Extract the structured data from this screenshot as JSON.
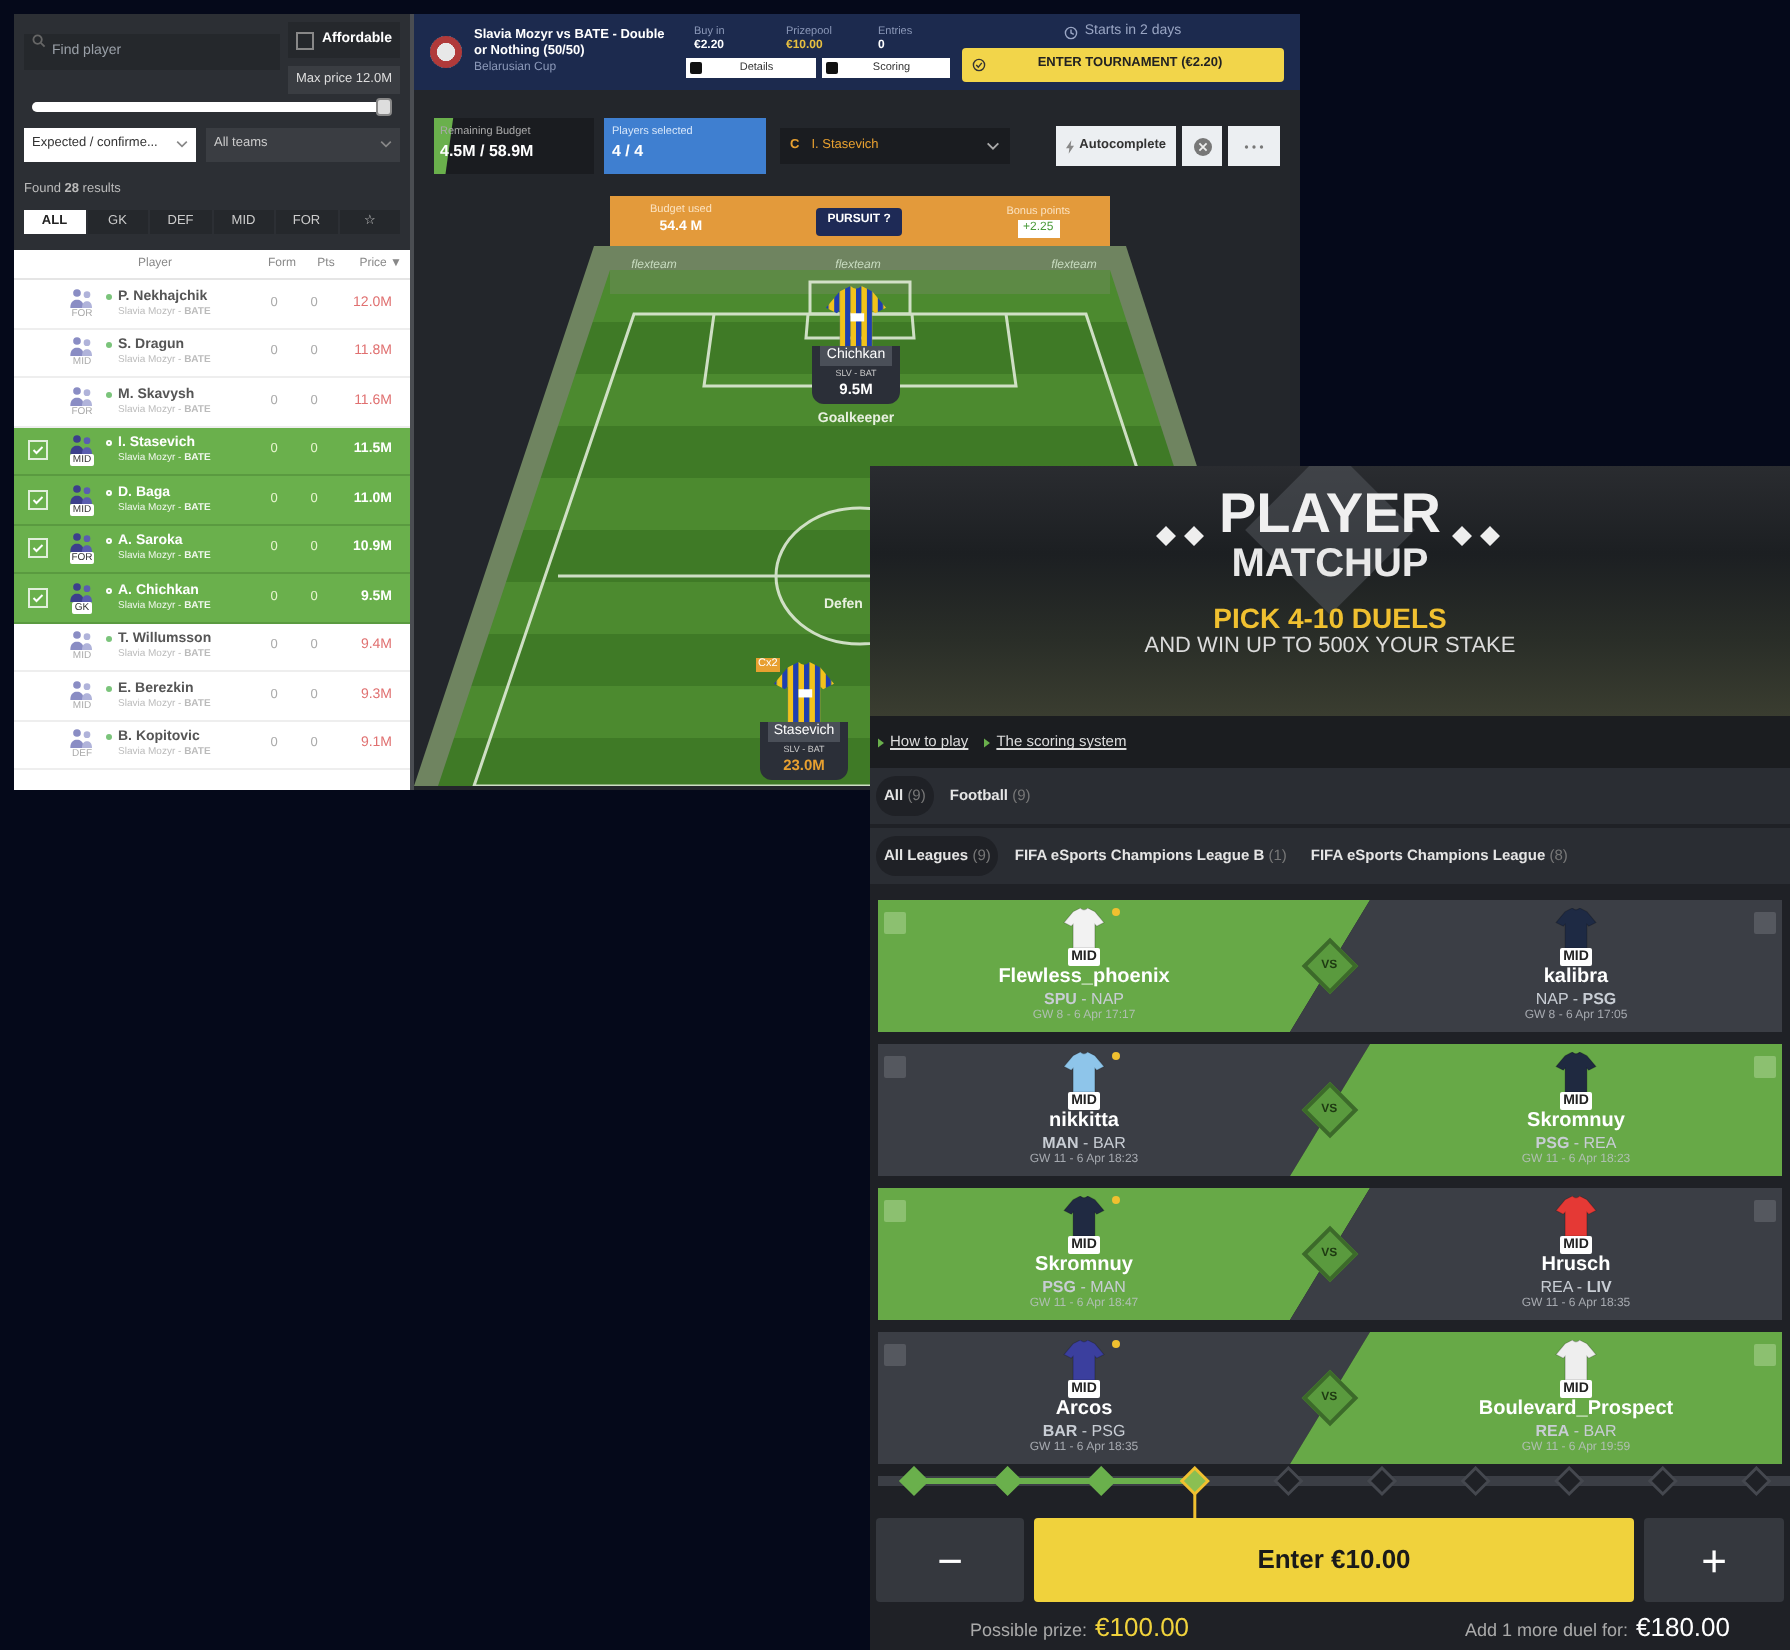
{
  "fantasy_screen": {
    "sidebar": {
      "search": {
        "placeholder": "Find player"
      },
      "affordable": {
        "label": "Affordable",
        "checked": false
      },
      "max_price": "Max price 12.0M",
      "price_slider": {
        "level": 1
      },
      "filters": [
        {
          "value": "Expected / confirme...",
          "kind": "light"
        },
        {
          "value": "All teams",
          "kind": "dark"
        }
      ],
      "found": "Found **28** results",
      "position_tabs": [
        {
          "label": "ALL",
          "selected": true
        },
        {
          "label": "GK",
          "selected": false
        },
        {
          "label": "DEF",
          "selected": false
        },
        {
          "label": "MID",
          "selected": false
        },
        {
          "label": "FOR",
          "selected": false
        },
        {
          "label": "☆",
          "selected": false
        }
      ],
      "columns": [
        "Player",
        "Form",
        "Pts",
        "Price ▼"
      ],
      "players": [
        {
          "name": "P. Nekhajchik",
          "team": "Slavia Mozyr - **BATE**",
          "position": "FOR",
          "form": "0",
          "pts": "0",
          "price": "12.0M",
          "selected": false
        },
        {
          "name": "S. Dragun",
          "team": "Slavia Mozyr - **BATE**",
          "position": "MID",
          "form": "0",
          "pts": "0",
          "price": "11.8M",
          "selected": false
        },
        {
          "name": "M. Skavysh",
          "team": "Slavia Mozyr - **BATE**",
          "position": "FOR",
          "form": "0",
          "pts": "0",
          "price": "11.6M",
          "selected": false
        },
        {
          "name": "I. Stasevich",
          "team": "Slavia Mozyr - **BATE**",
          "position": "MID",
          "form": "0",
          "pts": "0",
          "price": "11.5M",
          "selected": true
        },
        {
          "name": "D. Baga",
          "team": "Slavia Mozyr - **BATE**",
          "position": "MID",
          "form": "0",
          "pts": "0",
          "price": "11.0M",
          "selected": true
        },
        {
          "name": "A. Saroka",
          "team": "Slavia Mozyr - **BATE**",
          "position": "FOR",
          "form": "0",
          "pts": "0",
          "price": "10.9M",
          "selected": true
        },
        {
          "name": "A. Chichkan",
          "team": "Slavia Mozyr - **BATE**",
          "position": "GK",
          "form": "0",
          "pts": "0",
          "price": "9.5M",
          "selected": true
        },
        {
          "name": "T. Willumsson",
          "team": "Slavia Mozyr - **BATE**",
          "position": "MID",
          "form": "0",
          "pts": "0",
          "price": "9.4M",
          "selected": false
        },
        {
          "name": "E. Berezkin",
          "team": "Slavia Mozyr - **BATE**",
          "position": "MID",
          "form": "0",
          "pts": "0",
          "price": "9.3M",
          "selected": false
        },
        {
          "name": "B. Kopitovic",
          "team": "Slavia Mozyr - **BATE**",
          "position": "DEF",
          "form": "0",
          "pts": "0",
          "price": "9.1M",
          "selected": false
        }
      ]
    },
    "match_header": {
      "title": "Slavia Mozyr vs BATE - Double or Nothing (50/50)",
      "competition": "Belarusian Cup",
      "stats": [
        {
          "label": "Buy in",
          "value": "€2.20",
          "kind": "plain"
        },
        {
          "label": "Prizepool",
          "value": "€10.00",
          "kind": "highlight"
        },
        {
          "label": "Entries",
          "value": "0",
          "kind": "plain"
        }
      ],
      "links": [
        "Details",
        "Scoring"
      ],
      "start_time": "Starts in 2 days",
      "enter_button": "ENTER TOURNAMENT (€2.20)"
    },
    "team_bar": {
      "remaining_budget": {
        "label": "Remaining Budget",
        "value": "4.5M / 58.9M",
        "level": 0.12
      },
      "players_selected": {
        "label": "Players selected",
        "value": "4 / 4"
      },
      "captain": {
        "badge": "C",
        "name": "I. Stasevich"
      },
      "autocomplete": "Autocomplete"
    },
    "budget_banner": {
      "budget_label": "Budget used",
      "budget_value": "54.4 M",
      "mode": "PURSUIT ?",
      "bonus_label": "Bonus points",
      "bonus_value": "+2.25"
    },
    "pitch": {
      "sponsor_logos": [
        "flexteam",
        "flexteam",
        "flexteam"
      ],
      "players": [
        {
          "name": "Chichkan",
          "teams": "SLV - BAT",
          "price": "9.5M",
          "captain": false
        },
        {
          "name": "Stasevich",
          "teams": "SLV - BAT",
          "price": "23.0M",
          "captain": true,
          "captain_badge": "Cx2"
        }
      ],
      "position_labels": [
        "Goalkeeper",
        "Defen"
      ]
    }
  },
  "matchup_screen": {
    "hero": {
      "logo_top": "PLAYER",
      "logo_bottom": "MATCHUP",
      "headline": "PICK 4-10 DUELS",
      "subline": "AND WIN UP TO 500X YOUR STAKE"
    },
    "links": [
      "How to play",
      "The scoring system"
    ],
    "sport_tabs": [
      {
        "label": "All",
        "count": "(9)",
        "selected": true
      },
      {
        "label": "Football",
        "count": "(9)",
        "selected": false
      }
    ],
    "league_tabs": [
      {
        "label": "All Leagues",
        "count": "(9)",
        "selected": true
      },
      {
        "label": "FIFA eSports Champions League B",
        "count": "(1)",
        "selected": false
      },
      {
        "label": "FIFA eSports Champions League",
        "count": "(8)",
        "selected": false
      }
    ],
    "duels": [
      {
        "vs": "VS",
        "players": [
          {
            "name": "Flewless_phoenix",
            "position": "MID",
            "teams": "**SPU** - NAP",
            "time": "GW 8 - 6 Apr 17:17",
            "color": "#f2f2f2",
            "starred": true,
            "selected": true
          },
          {
            "name": "kalibra",
            "position": "MID",
            "teams": "NAP - **PSG**",
            "time": "GW 8 - 6 Apr 17:05",
            "color": "#1e2a44",
            "starred": false,
            "selected": false
          }
        ]
      },
      {
        "vs": "VS",
        "players": [
          {
            "name": "nikkitta",
            "position": "MID",
            "teams": "**MAN** - BAR",
            "time": "GW 11 - 6 Apr 18:23",
            "color": "#8ec5ea",
            "starred": true,
            "selected": false
          },
          {
            "name": "Skromnuy",
            "position": "MID",
            "teams": "**PSG** - REA",
            "time": "GW 11 - 6 Apr 18:23",
            "color": "#1f2940",
            "starred": false,
            "selected": true
          }
        ]
      },
      {
        "vs": "VS",
        "players": [
          {
            "name": "Skromnuy",
            "position": "MID",
            "teams": "**PSG** - MAN",
            "time": "GW 11 - 6 Apr 18:47",
            "color": "#202a42",
            "starred": true,
            "selected": true
          },
          {
            "name": "Hrusch",
            "position": "MID",
            "teams": "REA - **LIV**",
            "time": "GW 11 - 6 Apr 18:35",
            "color": "#e53935",
            "starred": false,
            "selected": false
          }
        ]
      },
      {
        "vs": "VS",
        "players": [
          {
            "name": "Arcos",
            "position": "MID",
            "teams": "**BAR** - PSG",
            "time": "GW 11 - 6 Apr 18:35",
            "color": "#3b3f9e",
            "starred": true,
            "selected": false
          },
          {
            "name": "Boulevard_Prospect",
            "position": "MID",
            "teams": "**REA** - BAR",
            "time": "GW 11 - 6 Apr 19:59",
            "color": "#eeeeee",
            "starred": false,
            "selected": true
          }
        ]
      }
    ],
    "steps": [
      {
        "done": true,
        "current": false
      },
      {
        "done": true,
        "current": false
      },
      {
        "done": true,
        "current": false
      },
      {
        "done": false,
        "current": true
      },
      {
        "done": false,
        "current": false
      },
      {
        "done": false,
        "current": false
      },
      {
        "done": false,
        "current": false
      },
      {
        "done": false,
        "current": false
      },
      {
        "done": false,
        "current": false
      },
      {
        "done": false,
        "current": false
      }
    ],
    "minus": "−",
    "enter": "Enter €10.00",
    "plus": "+",
    "prize_label": "Possible prize:",
    "prize_value": "€100.00",
    "more_label": "Add 1 more duel for:",
    "more_value": "€180.00"
  }
}
